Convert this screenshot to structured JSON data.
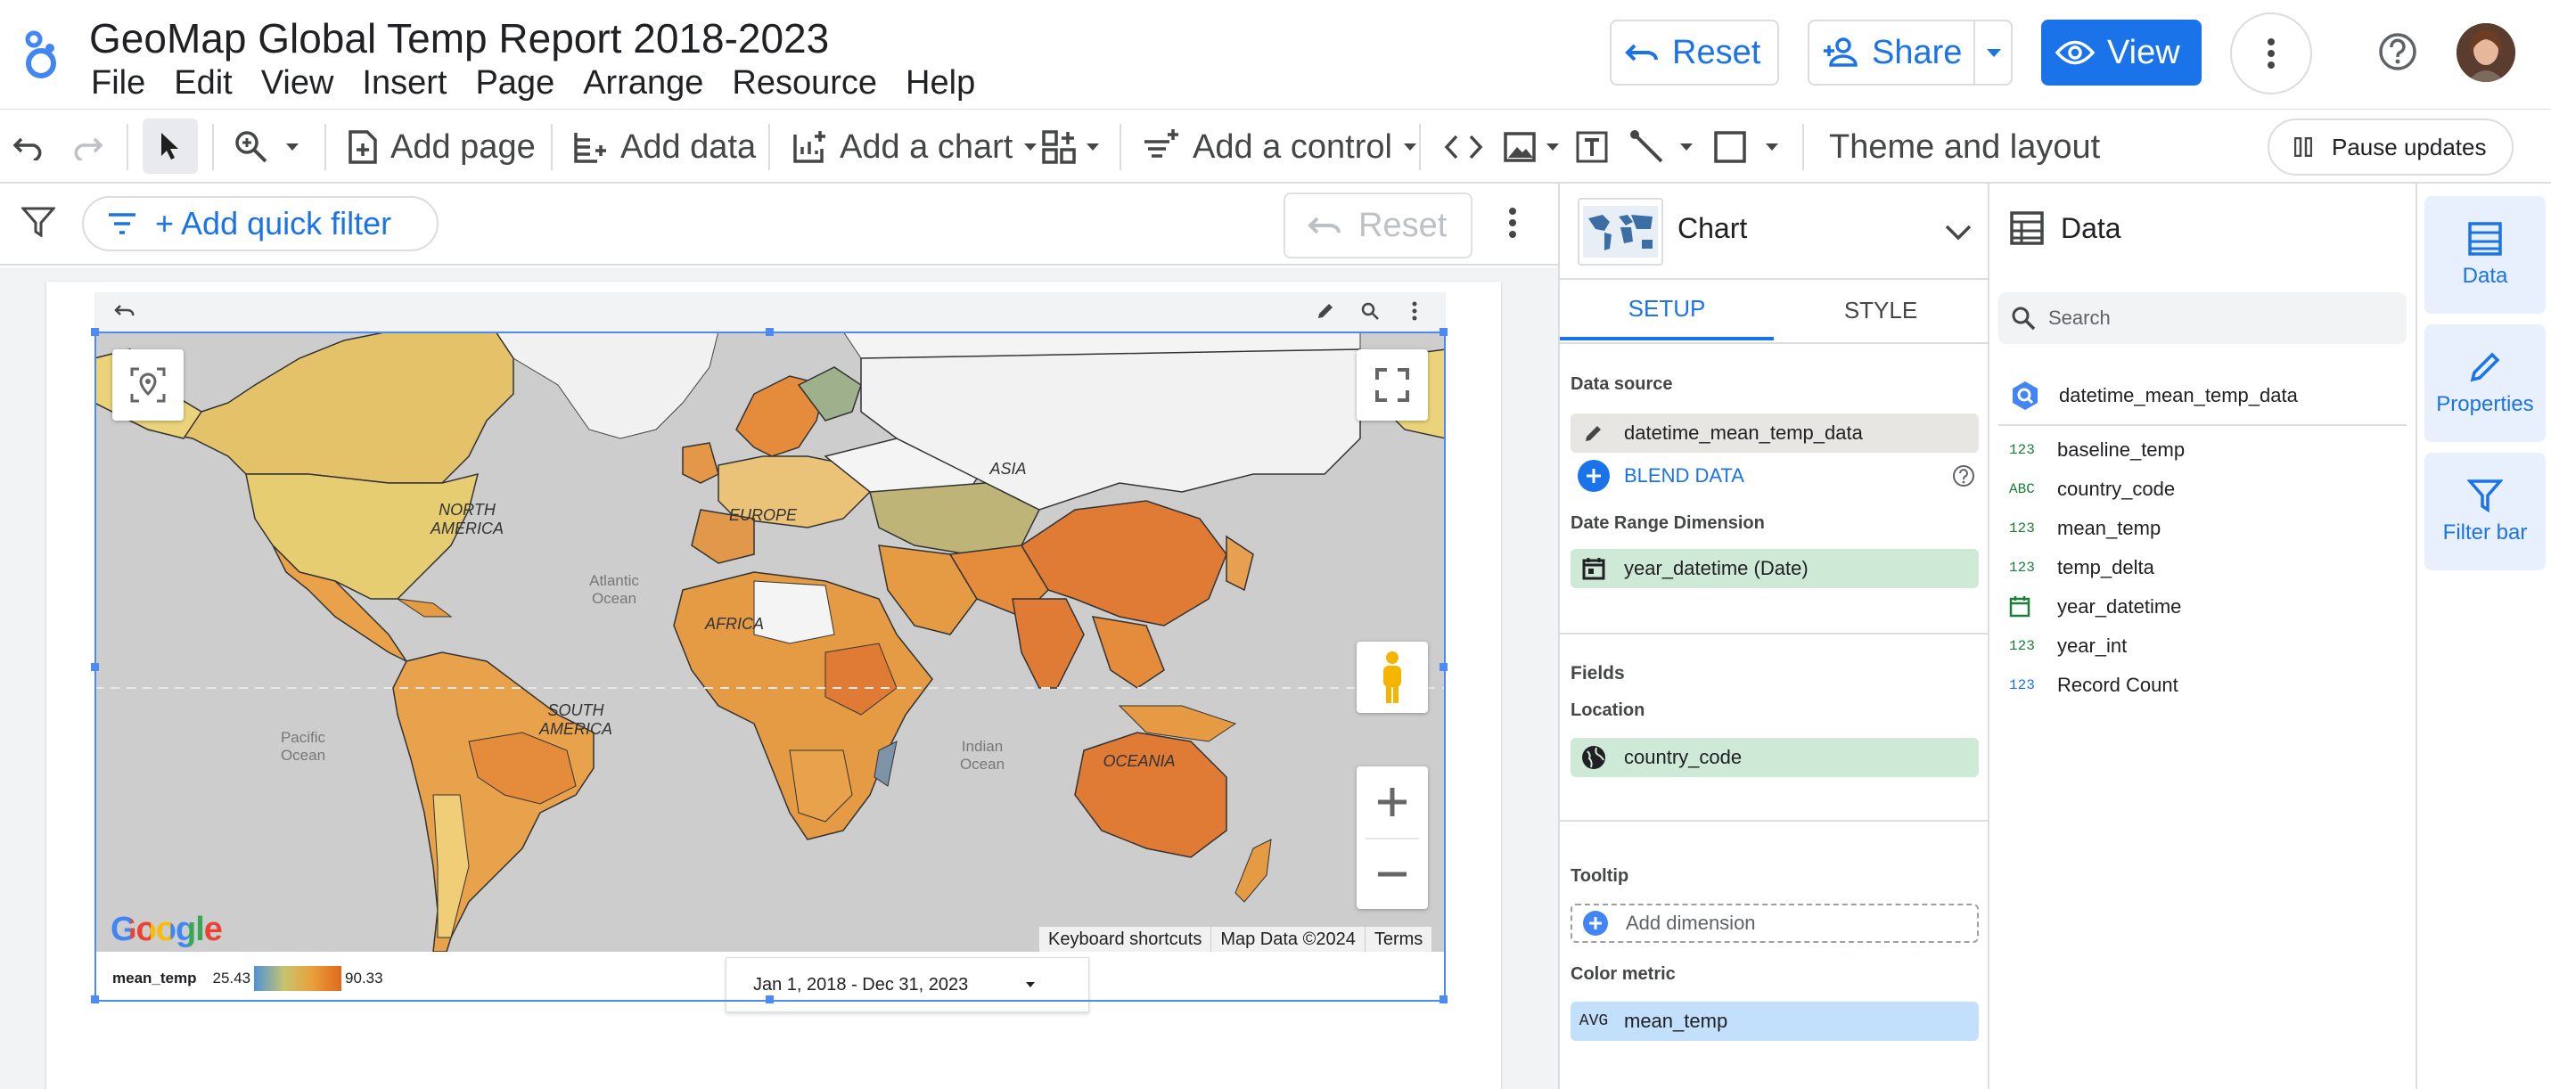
{
  "header": {
    "title": "GeoMap Global Temp Report 2018-2023",
    "menu": [
      "File",
      "Edit",
      "View",
      "Insert",
      "Page",
      "Arrange",
      "Resource",
      "Help"
    ],
    "reset_label": "Reset",
    "share_label": "Share",
    "view_label": "View"
  },
  "toolbar": {
    "add_page": "Add page",
    "add_data": "Add data",
    "add_chart": "Add a chart",
    "add_control": "Add a control",
    "theme_layout": "Theme and layout",
    "pause_updates": "Pause updates"
  },
  "filterbar": {
    "quick_filter": "+ Add quick filter",
    "reset_label": "Reset"
  },
  "map": {
    "continent_labels": [
      "NORTH AMERICA",
      "SOUTH AMERICA",
      "EUROPE",
      "AFRICA",
      "ASIA",
      "OCEANIA"
    ],
    "ocean_labels": [
      "Atlantic Ocean",
      "Pacific Ocean",
      "Indian Ocean"
    ],
    "google_logo": "Google",
    "footer": [
      "Keyboard shortcuts",
      "Map Data ©2024",
      "Terms"
    ],
    "legend": {
      "metric": "mean_temp",
      "min": "25.43",
      "max": "90.33"
    },
    "date_range": "Jan 1, 2018 - Dec 31, 2023"
  },
  "chart_panel": {
    "title": "Chart",
    "tab_setup": "SETUP",
    "tab_style": "STYLE",
    "data_source_label": "Data source",
    "data_source": "datetime_mean_temp_data",
    "blend_data": "BLEND DATA",
    "date_range_label": "Date Range Dimension",
    "date_range_field": "year_datetime (Date)",
    "fields_label": "Fields",
    "location_label": "Location",
    "location_field": "country_code",
    "tooltip_label": "Tooltip",
    "add_dimension": "Add dimension",
    "color_metric_label": "Color metric",
    "color_metric_agg": "AVG",
    "color_metric_field": "mean_temp"
  },
  "data_panel": {
    "title": "Data",
    "search_placeholder": "Search",
    "source": "datetime_mean_temp_data",
    "fields": [
      {
        "type": "123",
        "name": "baseline_temp"
      },
      {
        "type": "ABC",
        "name": "country_code"
      },
      {
        "type": "123",
        "name": "mean_temp"
      },
      {
        "type": "123",
        "name": "temp_delta"
      },
      {
        "type": "date",
        "name": "year_datetime"
      },
      {
        "type": "123",
        "name": "year_int"
      },
      {
        "type": "123",
        "name": "Record Count"
      }
    ]
  },
  "side_tabs": [
    "Data",
    "Properties",
    "Filter bar"
  ],
  "colors": {
    "accent": "#1a73e8",
    "selection": "#4c8bf5",
    "dimension_chip": "#ceead6",
    "metric_chip": "#c2e0fb",
    "source_chip": "#e8e6e3"
  }
}
